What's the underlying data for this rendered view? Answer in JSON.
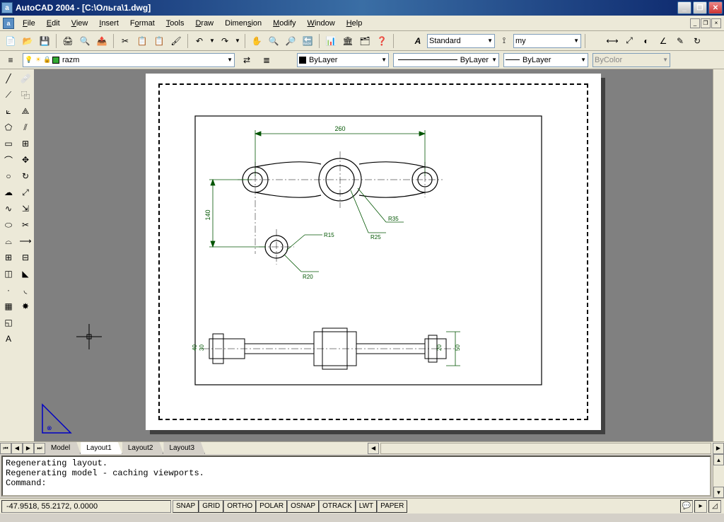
{
  "title": "AutoCAD 2004 - [C:\\Ольга\\1.dwg]",
  "menu": [
    "File",
    "Edit",
    "View",
    "Insert",
    "Format",
    "Tools",
    "Draw",
    "Dimension",
    "Modify",
    "Window",
    "Help"
  ],
  "menu_underline_idx": [
    0,
    0,
    0,
    0,
    1,
    0,
    0,
    5,
    0,
    0,
    0
  ],
  "text_style": "Standard",
  "dim_style": "my",
  "layer_name": "razm",
  "prop_color": "ByLayer",
  "prop_ltype": "ByLayer",
  "prop_lweight": "ByLayer",
  "prop_plotstyle": "ByColor",
  "tabs": [
    "Model",
    "Layout1",
    "Layout2",
    "Layout3"
  ],
  "active_tab": 1,
  "command_history": [
    "Regenerating layout.",
    "Regenerating model - caching viewports."
  ],
  "command_prompt": "Command:",
  "coords": "-47.9518, 55.2172, 0.0000",
  "status_toggles": [
    "SNAP",
    "GRID",
    "ORTHO",
    "POLAR",
    "OSNAP",
    "OTRACK",
    "LWT",
    "PAPER"
  ],
  "dim_labels": {
    "w260": "260",
    "h": "140",
    "r15": "R15",
    "r20": "R20",
    "r25": "R25",
    "r35": "R35",
    "d30": "30",
    "d40": "40",
    "d20": "20",
    "d50": "50"
  }
}
